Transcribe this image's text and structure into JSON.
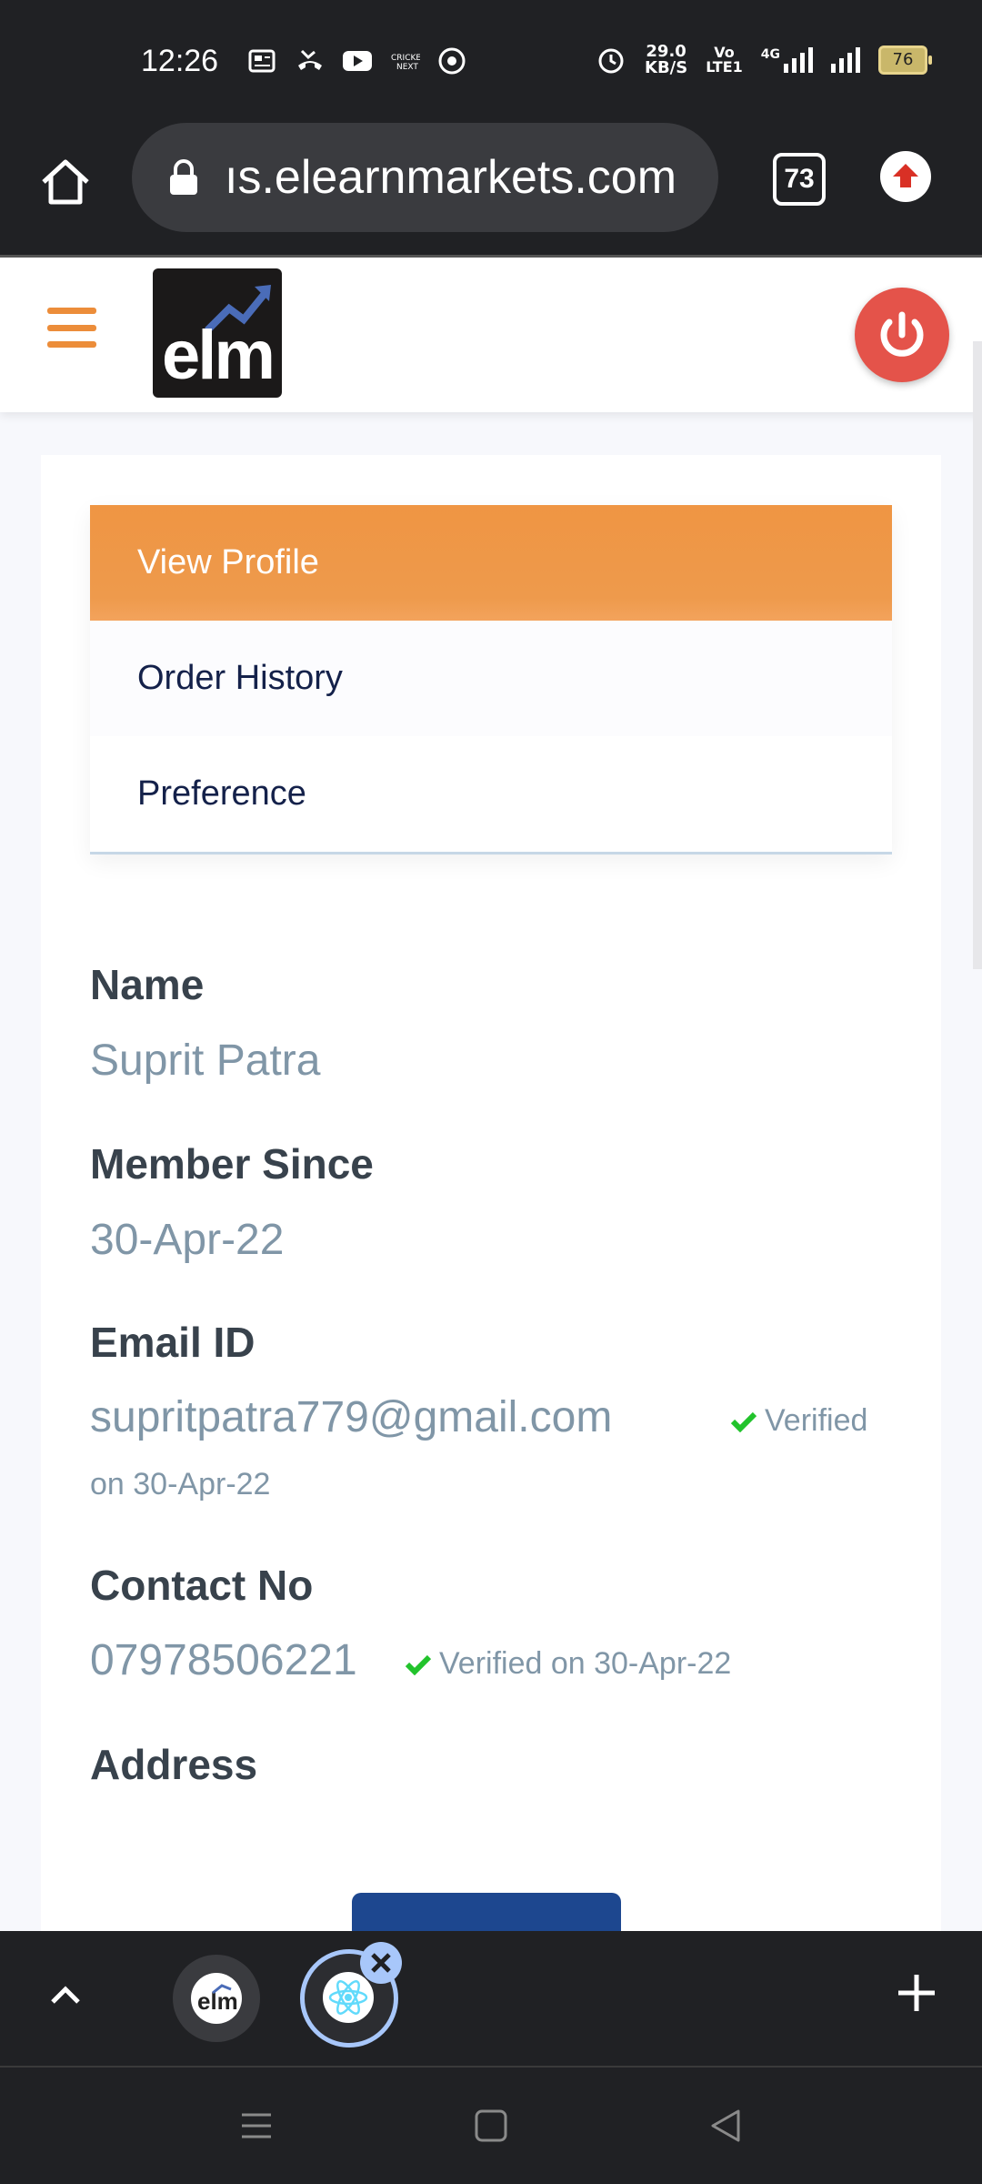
{
  "status_bar": {
    "time": "12:26",
    "net_speed_value": "29.0",
    "net_speed_unit": "KB/S",
    "volte_top": "Vo",
    "volte_bottom": "LTE1",
    "network_type": "4G",
    "battery": "76",
    "icons": [
      "news-icon",
      "missed-call-icon",
      "youtube-icon",
      "cricket-next-icon",
      "chrome-icon",
      "alarm-icon",
      "signal-icon",
      "signal-icon"
    ]
  },
  "browser": {
    "url": "ıs.elearnmarkets.com",
    "tab_count": "73"
  },
  "site": {
    "logo_text": "elm",
    "brand_color": "#ef9543",
    "power_color": "#e4534a"
  },
  "menu": {
    "items": [
      {
        "label": "View Profile",
        "active": true
      },
      {
        "label": "Order History",
        "active": false
      },
      {
        "label": "Preference",
        "active": false
      }
    ]
  },
  "profile": {
    "name_label": "Name",
    "name_value": "Suprit Patra",
    "member_label": "Member Since",
    "member_value": "30-Apr-22",
    "email_label": "Email ID",
    "email_value": "supritpatra779@gmail.com",
    "email_verified_1": "Verified",
    "email_verified_2": "on 30-Apr-22",
    "contact_label": "Contact No",
    "contact_value": "07978506221",
    "contact_verified": "Verified on 30-Apr-22",
    "address_label": "Address"
  }
}
